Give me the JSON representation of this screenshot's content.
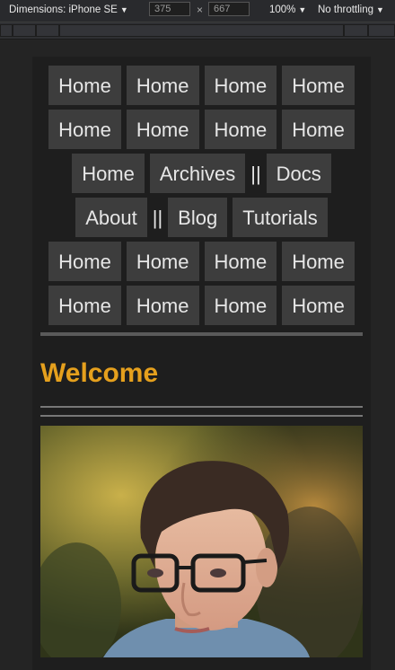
{
  "devtools": {
    "dimensions_label": "Dimensions: iPhone SE",
    "width_value": "375",
    "height_value": "667",
    "times_symbol": "×",
    "zoom_label": "100%",
    "throttle_label": "No throttling",
    "caret": "▼"
  },
  "nav": {
    "rows": [
      [
        "Home",
        "Home",
        "Home",
        "Home"
      ],
      [
        "Home",
        "Home",
        "Home",
        "Home"
      ],
      [
        "Home",
        "Archives",
        "||",
        "Docs"
      ],
      [
        "About",
        "||",
        "Blog",
        "Tutorials"
      ],
      [
        "Home",
        "Home",
        "Home",
        "Home"
      ],
      [
        "Home",
        "Home",
        "Home",
        "Home"
      ]
    ]
  },
  "main": {
    "heading": "Welcome"
  },
  "colors": {
    "heading": "#e5a01d",
    "button_bg": "#3d3d3d",
    "page_bg": "#1e1e1e"
  }
}
